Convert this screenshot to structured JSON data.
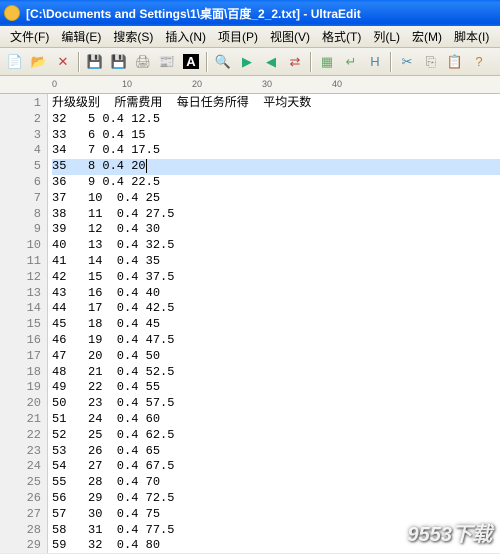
{
  "title": "[C:\\Documents and Settings\\1\\桌面\\百度_2_2.txt] - UltraEdit",
  "menus": [
    "文件(F)",
    "编辑(E)",
    "搜索(S)",
    "插入(N)",
    "项目(P)",
    "视图(V)",
    "格式(T)",
    "列(L)",
    "宏(M)",
    "脚本(I)"
  ],
  "toolbar_icons": [
    {
      "name": "new-file-icon",
      "glyph": "📄",
      "color": "#fff"
    },
    {
      "name": "open-folder-icon",
      "glyph": "📂",
      "color": "#f5c040"
    },
    {
      "name": "close-icon",
      "glyph": "✕",
      "color": "#c04040"
    },
    {
      "name": "save-icon",
      "glyph": "💾",
      "color": "#4060c0"
    },
    {
      "name": "save-all-icon",
      "glyph": "💾",
      "color": "#4060c0"
    },
    {
      "name": "print-icon",
      "glyph": "🖨",
      "color": "#888"
    },
    {
      "name": "print-preview-icon",
      "glyph": "📰",
      "color": "#888"
    },
    {
      "name": "mark-icon",
      "glyph": "A",
      "color": "#fff",
      "bg": "#000"
    },
    {
      "name": "find-icon",
      "glyph": "🔍",
      "color": "#555"
    },
    {
      "name": "find-next-icon",
      "glyph": "▶",
      "color": "#2a7"
    },
    {
      "name": "find-prev-icon",
      "glyph": "◀",
      "color": "#2a7"
    },
    {
      "name": "replace-icon",
      "glyph": "⇄",
      "color": "#c04040"
    },
    {
      "name": "column-mode-icon",
      "glyph": "▦",
      "color": "#6a6"
    },
    {
      "name": "wrap-icon",
      "glyph": "↵",
      "color": "#6a6"
    },
    {
      "name": "hex-icon",
      "glyph": "H",
      "color": "#48a"
    },
    {
      "name": "cut-icon",
      "glyph": "✂",
      "color": "#48a"
    },
    {
      "name": "copy-icon",
      "glyph": "⎘",
      "color": "#888"
    },
    {
      "name": "paste-icon",
      "glyph": "📋",
      "color": "#c88020"
    },
    {
      "name": "help-icon",
      "glyph": "?",
      "color": "#c88020"
    }
  ],
  "ruler_marks": [
    {
      "pos": 0,
      "label": "0"
    },
    {
      "pos": 70,
      "label": "10"
    },
    {
      "pos": 140,
      "label": "20"
    },
    {
      "pos": 210,
      "label": "30"
    },
    {
      "pos": 280,
      "label": "40"
    }
  ],
  "highlight_line": 5,
  "lines": [
    "升级级别  所需费用  每日任务所得  平均天数",
    "32   5 0.4 12.5",
    "33   6 0.4 15",
    "34   7 0.4 17.5",
    "35   8 0.4 20",
    "36   9 0.4 22.5",
    "37   10  0.4 25",
    "38   11  0.4 27.5",
    "39   12  0.4 30",
    "40   13  0.4 32.5",
    "41   14  0.4 35",
    "42   15  0.4 37.5",
    "43   16  0.4 40",
    "44   17  0.4 42.5",
    "45   18  0.4 45",
    "46   19  0.4 47.5",
    "47   20  0.4 50",
    "48   21  0.4 52.5",
    "49   22  0.4 55",
    "50   23  0.4 57.5",
    "51   24  0.4 60",
    "52   25  0.4 62.5",
    "53   26  0.4 65",
    "54   27  0.4 67.5",
    "55   28  0.4 70",
    "56   29  0.4 72.5",
    "57   30  0.4 75",
    "58   31  0.4 77.5",
    "59   32  0.4 80"
  ],
  "watermark": "9553下载"
}
